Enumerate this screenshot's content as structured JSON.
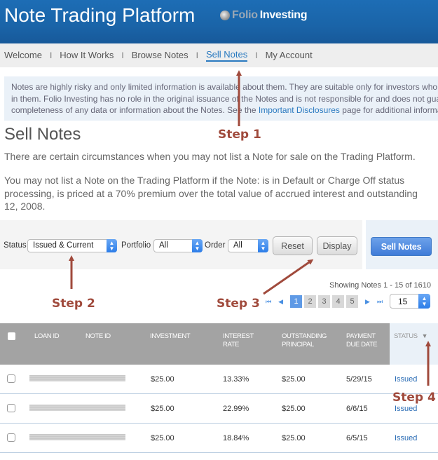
{
  "header": {
    "title": "Note Trading Platform",
    "logo": {
      "part1": "Folio",
      "part2": "Investing"
    }
  },
  "nav": {
    "items": [
      {
        "label": "Welcome",
        "active": false
      },
      {
        "label": "How It Works",
        "active": false
      },
      {
        "label": "Browse Notes",
        "active": false
      },
      {
        "label": "Sell Notes",
        "active": true
      },
      {
        "label": "My Account",
        "active": false
      }
    ],
    "separator": "I"
  },
  "notice": {
    "line1": "Notes are highly risky and only limited information is available about them. They are suitable only for investors who can afford to lose their investment",
    "line2": "in them. Folio Investing has no role in the original issuance of the Notes and is not responsible for and does not guarantee the accuracy or",
    "line3_pre": "completeness of any data or information about the Notes. See the ",
    "line3_link": "Important Disclosures",
    "line3_post": " page for additional information."
  },
  "page": {
    "title": "Sell Notes",
    "para1": "There are certain circumstances when you may not list a Note for sale on the Trading Platform.",
    "para2_line1": "You may not list a Note on the Trading Platform if the Note: is in Default or Charge Off status",
    "para2_line2": "processing, is priced at a 70% premium over the total value of accrued interest and outstanding",
    "para2_line3": "12, 2008."
  },
  "filters": {
    "status_label": "Status",
    "status_value": "Issued & Current",
    "portfolio_label": "Portfolio",
    "portfolio_value": "All",
    "order_label": "Order",
    "order_value": "All",
    "reset_label": "Reset",
    "display_label": "Display",
    "sell_label": "Sell Notes"
  },
  "pagination": {
    "showing": "Showing Notes 1 - 15 of 1610",
    "pages": [
      "1",
      "2",
      "3",
      "4",
      "5"
    ],
    "current_page": "1",
    "per_page": "15",
    "first_icon": "⏮",
    "prev_icon": "◀",
    "next_icon": "▶",
    "last_icon": "⏭"
  },
  "table": {
    "columns": {
      "loan_id": "LOAN ID",
      "note_id": "NOTE ID",
      "investment": "INVESTMENT",
      "interest_rate_1": "INTEREST",
      "interest_rate_2": "RATE",
      "outstanding_1": "OUTSTANDING",
      "outstanding_2": "PRINCIPAL",
      "payment_1": "PAYMENT",
      "payment_2": "DUE DATE",
      "status": "STATUS"
    },
    "rows": [
      {
        "investment": "$25.00",
        "rate": "13.33%",
        "principal": "$25.00",
        "due": "5/29/15",
        "status": "Issued"
      },
      {
        "investment": "$25.00",
        "rate": "22.99%",
        "principal": "$25.00",
        "due": "6/6/15",
        "status": "Issued"
      },
      {
        "investment": "$25.00",
        "rate": "18.84%",
        "principal": "$25.00",
        "due": "6/5/15",
        "status": "Issued"
      }
    ]
  },
  "annotations": {
    "step1": "Step 1",
    "step2": "Step 2",
    "step3": "Step 3",
    "step4": "Step 4",
    "color": "#a04a3c"
  }
}
